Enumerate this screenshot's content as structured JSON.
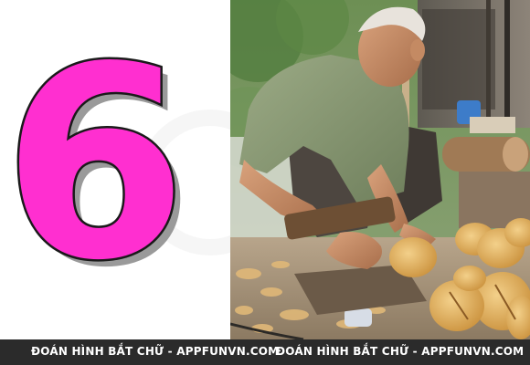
{
  "puzzle": {
    "number": "6",
    "number_color": "#ff2fd0",
    "number_outline_color": "#1a1a1a",
    "number_shadow_color": "#9a9a9a"
  },
  "photo": {
    "subject": "elderly man carving wood"
  },
  "footer": {
    "caption_left": "ĐOÁN HÌNH BẮT CHỮ - APPFUNVN.COM",
    "caption_right": "ĐOÁN HÌNH BẮT CHỮ - APPFUNVN.COM",
    "bar_color": "#2b2b2b"
  }
}
